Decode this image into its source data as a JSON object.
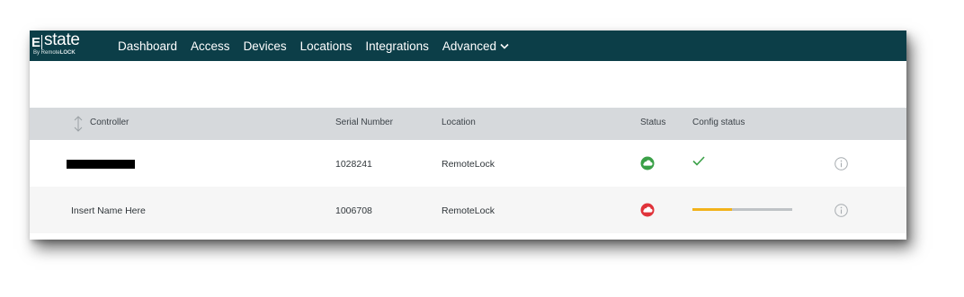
{
  "brand": {
    "letter": "E",
    "name": "state",
    "by_prefix": "By Remote",
    "by_bold": "LOCK"
  },
  "nav": {
    "items": [
      "Dashboard",
      "Access",
      "Devices",
      "Locations",
      "Integrations"
    ],
    "advanced_label": "Advanced"
  },
  "table": {
    "headers": {
      "controller": "Controller",
      "serial": "Serial Number",
      "location": "Location",
      "status": "Status",
      "config": "Config status"
    },
    "rows": [
      {
        "name": "",
        "name_redacted": true,
        "serial": "1028241",
        "location": "RemoteLock",
        "status": "online",
        "status_color": "#3aa047",
        "config": "complete"
      },
      {
        "name": "Insert Name Here",
        "name_redacted": false,
        "serial": "1006708",
        "location": "RemoteLock",
        "status": "offline",
        "status_color": "#e0333a",
        "config": "in-progress",
        "config_progress_fraction": 0.4
      }
    ]
  },
  "colors": {
    "nav_bg": "#0c3e48",
    "header_bg": "#d6d9dc",
    "check": "#3aa047",
    "progress": "#f2b21b"
  }
}
